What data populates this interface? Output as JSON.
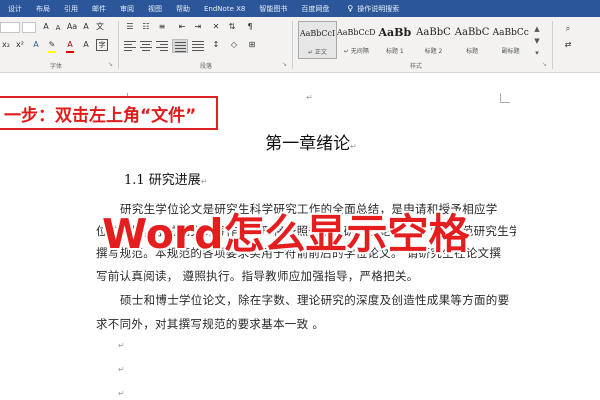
{
  "ribbon_tabs": [
    "设计",
    "布局",
    "引用",
    "邮件",
    "审阅",
    "视图",
    "帮助",
    "EndNote X8",
    "智能图书",
    "百度网盘"
  ],
  "tell_me": "操作说明搜索",
  "ribbon": {
    "font_size_value": "",
    "group_labels": {
      "font": "字体",
      "paragraph": "段落",
      "styles": "样式"
    },
    "style_gallery": [
      {
        "sample": "AaBbCcI",
        "name": "↵ 正文",
        "selected": true
      },
      {
        "sample": "AaBbCcD",
        "name": "↵ 无间隔",
        "selected": false
      },
      {
        "sample": "AaBb",
        "name": "标题 1",
        "selected": false
      },
      {
        "sample": "AaBbC",
        "name": "标题 2",
        "selected": false
      },
      {
        "sample": "AaBbC",
        "name": "标题",
        "selected": false
      },
      {
        "sample": "AaBbCc",
        "name": "副标题",
        "selected": false
      }
    ]
  },
  "document": {
    "paragraph_mark": "↵",
    "heading1": "第一章绪论",
    "heading2": "1.1 研究进展",
    "body_lines": [
      "研究生学位论文是研究生科学研究工作的全面总结，是申请和授予相应学",
      "位的依据，学位论文的写作应当严格按照规范，研究生论文，以下为规范研究生学位论文",
      "撰写规范。本规范的各项要求实用于符箭前后的学位论文。 请研究生在论文撰",
      "写前认真阅读， 遵照执行。指导教师应加强指导，严格把关。",
      "硕士和博士学位论文，除在字数、理论研究的深度及创造性成果等方面的要",
      "求不同外，对其撰写规范的要求基本一致 。"
    ]
  },
  "overlay": {
    "step_text": "一步：双击左上角“文件”",
    "title_text": "Word怎么显示空格"
  },
  "colors": {
    "ribbon_tab_bg": "#2b579a",
    "ribbon_bg": "#f3f2f1",
    "overlay_red": "#e41e1e"
  },
  "icons": [
    "lightbulb-icon",
    "bold-icon",
    "italic-icon",
    "underline-icon",
    "font-color-icon",
    "highlight-icon",
    "bullets-icon",
    "numbering-icon",
    "align-left-icon",
    "center-icon",
    "sort-icon",
    "pilcrow-icon",
    "gallery-more-icon"
  ]
}
